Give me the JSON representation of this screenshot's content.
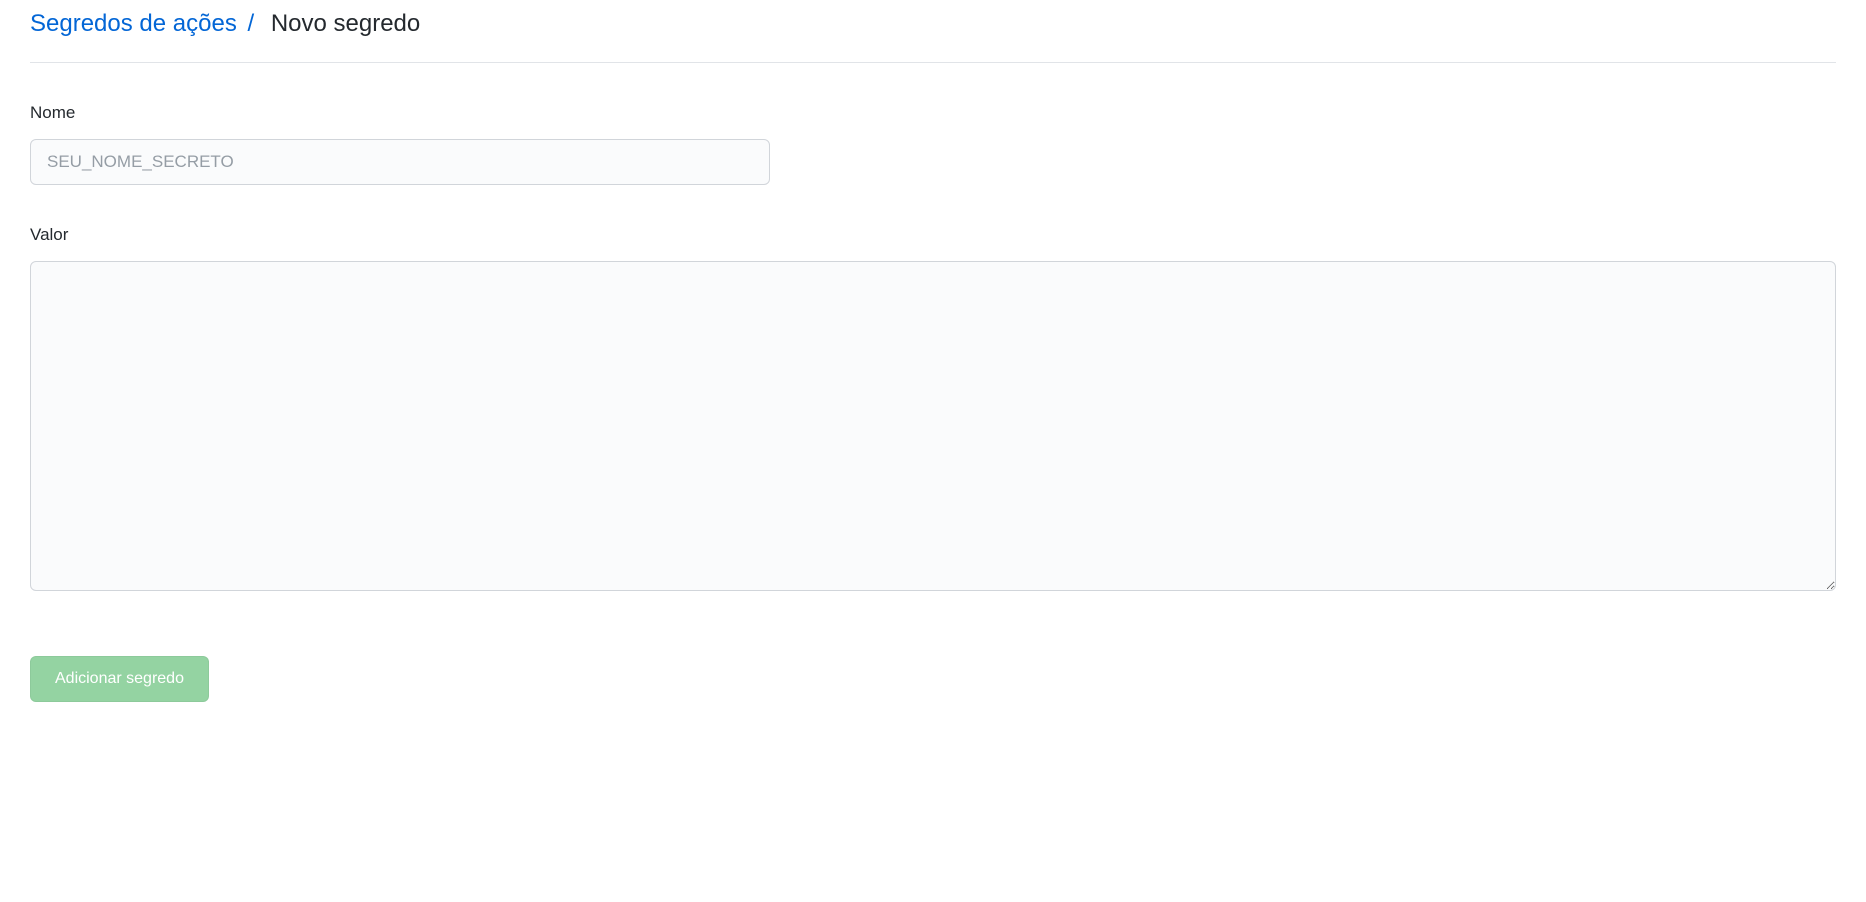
{
  "breadcrumb": {
    "link_label": "Segredos de ações",
    "separator": "/",
    "current": "Novo segredo"
  },
  "form": {
    "name": {
      "label": "Nome",
      "placeholder": "SEU_NOME_SECRETO",
      "value": ""
    },
    "value": {
      "label": "Valor",
      "value": ""
    },
    "submit_label": "Adicionar segredo"
  }
}
